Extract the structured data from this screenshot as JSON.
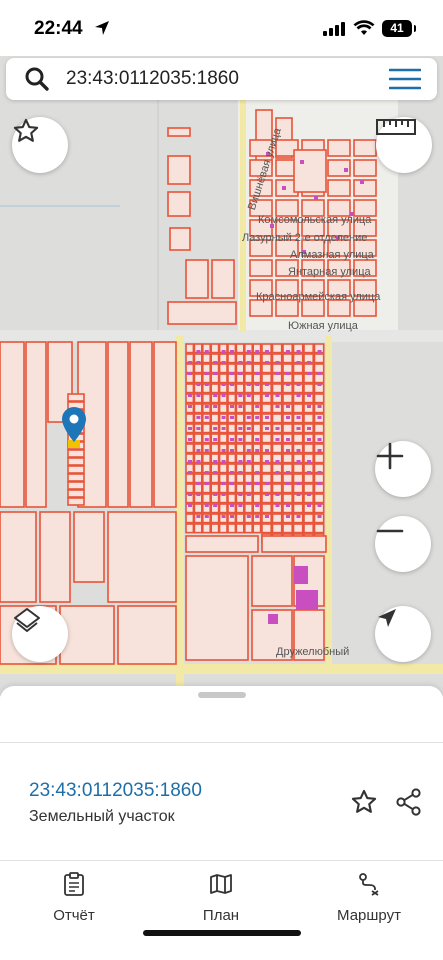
{
  "status_bar": {
    "time": "22:44",
    "battery": "41"
  },
  "search": {
    "query": "23:43:0112035:1860"
  },
  "map": {
    "streets": [
      "Вишнёвая улица",
      "Комсомольская улица",
      "Лазурный 2-е отделение",
      "Алмазная улица",
      "Янтарная улица",
      "Красноармейская улица",
      "Южная улица",
      "Дружелюбный"
    ],
    "icons": {
      "favorite": "star-icon",
      "ruler": "ruler-icon",
      "zoom_in": "plus-icon",
      "zoom_out": "minus-icon",
      "layers": "layers-icon",
      "locate": "navigation-arrow-icon",
      "marker": "map-pin-icon"
    }
  },
  "sheet": {
    "cadastral_number": "23:43:0112035:1860",
    "object_type": "Земельный участок"
  },
  "tabs": [
    {
      "label": "Отчёт",
      "icon": "clipboard-icon"
    },
    {
      "label": "План",
      "icon": "map-icon"
    },
    {
      "label": "Маршрут",
      "icon": "route-icon"
    }
  ],
  "colors": {
    "parcel": "#e8543a",
    "accent": "#1e6fa8",
    "road": "#f3e9a6"
  }
}
